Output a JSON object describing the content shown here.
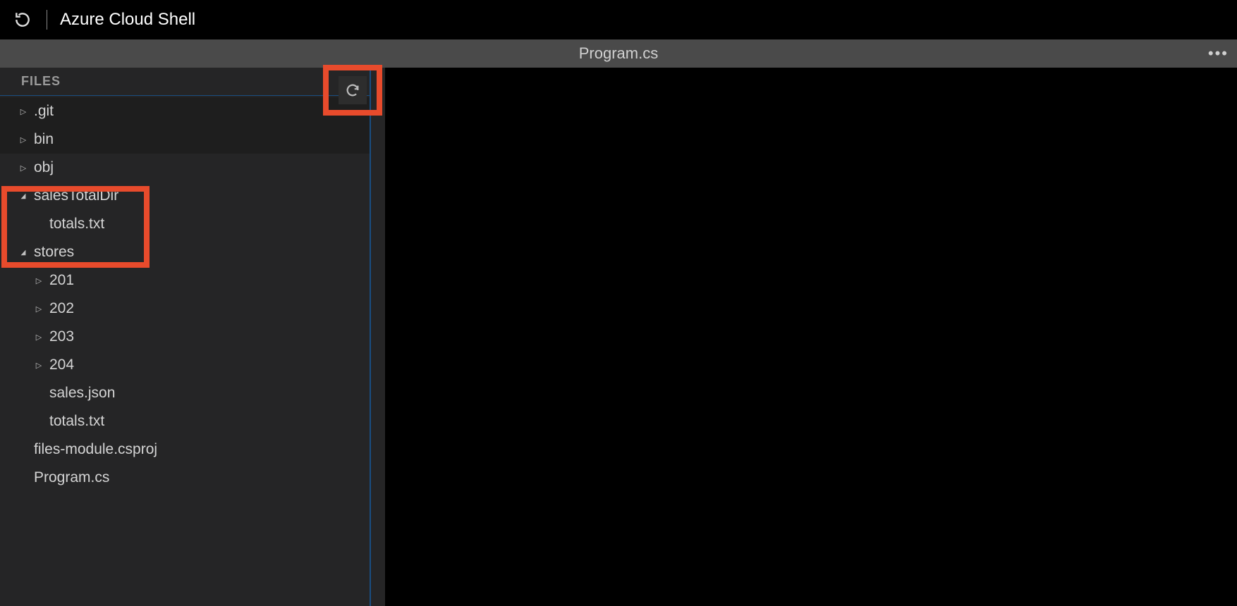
{
  "header": {
    "title": "Azure Cloud Shell"
  },
  "tab": {
    "title": "Program.cs"
  },
  "sidebar": {
    "label": "FILES",
    "tree": [
      {
        "name": ".git",
        "level": 0,
        "arrow": "right",
        "dark": true
      },
      {
        "name": "bin",
        "level": 0,
        "arrow": "right",
        "dark": true
      },
      {
        "name": "obj",
        "level": 0,
        "arrow": "right",
        "dark": false
      },
      {
        "name": "salesTotalDir",
        "level": 0,
        "arrow": "down",
        "dark": false
      },
      {
        "name": "totals.txt",
        "level": 1,
        "arrow": "",
        "dark": false
      },
      {
        "name": "stores",
        "level": 0,
        "arrow": "down",
        "dark": false
      },
      {
        "name": "201",
        "level": 1,
        "arrow": "right",
        "dark": false
      },
      {
        "name": "202",
        "level": 1,
        "arrow": "right",
        "dark": false
      },
      {
        "name": "203",
        "level": 1,
        "arrow": "right",
        "dark": false
      },
      {
        "name": "204",
        "level": 1,
        "arrow": "right",
        "dark": false
      },
      {
        "name": "sales.json",
        "level": 1,
        "arrow": "",
        "dark": false
      },
      {
        "name": "totals.txt",
        "level": 1,
        "arrow": "",
        "dark": false
      },
      {
        "name": "files-module.csproj",
        "level": 0,
        "arrow": "",
        "dark": false
      },
      {
        "name": "Program.cs",
        "level": 0,
        "arrow": "",
        "dark": false
      }
    ]
  }
}
